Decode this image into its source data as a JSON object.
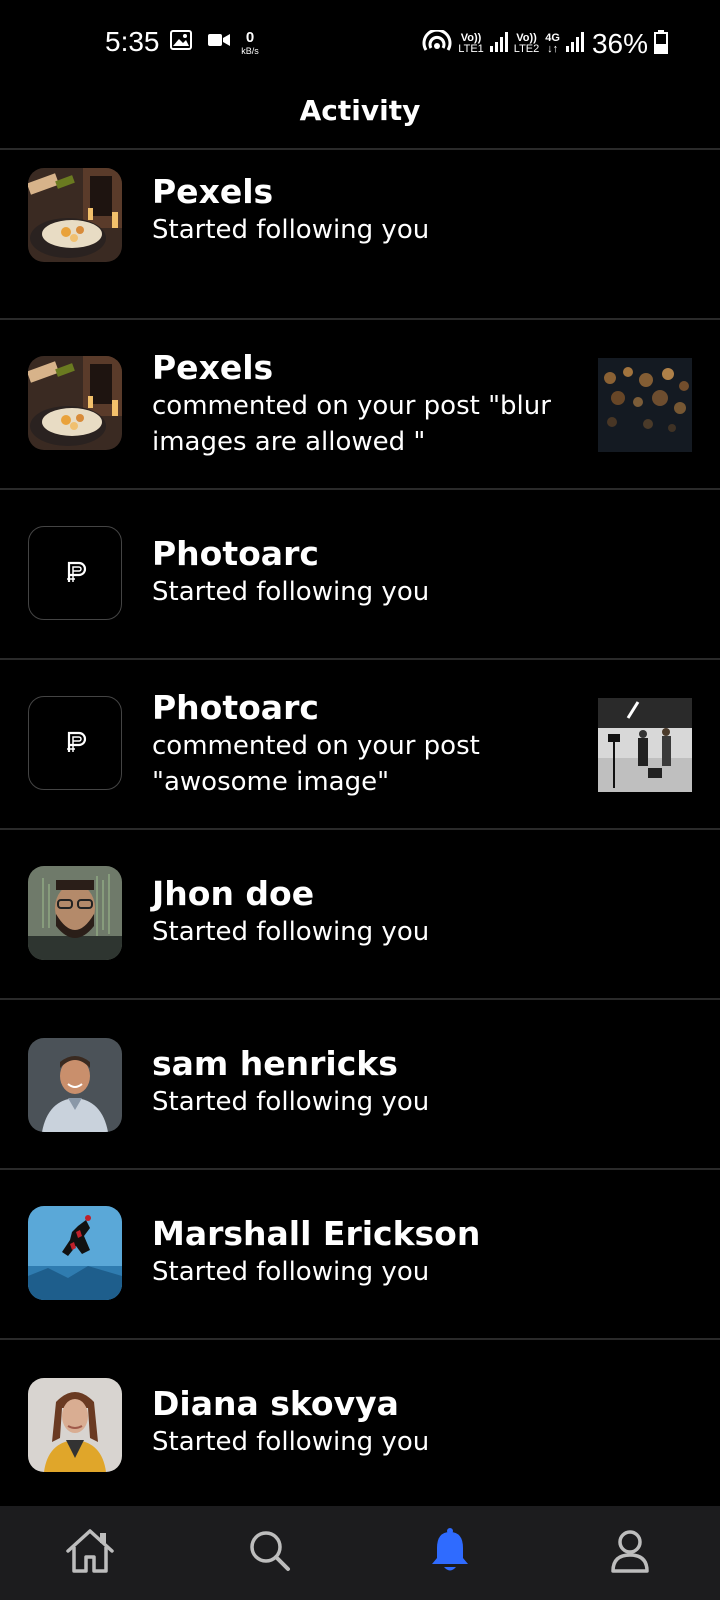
{
  "status_bar": {
    "time": "5:35",
    "net_speed_value": "0",
    "net_speed_unit": "kB/s",
    "sim1_top": "Vo))",
    "sim1_bottom": "LTE1",
    "sim2_top": "Vo))",
    "sim2_bottom": "LTE2",
    "network_type": "4G",
    "battery": "36%",
    "icons_left": [
      "gallery-icon",
      "video-camera-icon"
    ],
    "icons_right": [
      "hotspot-icon",
      "signal-icon",
      "signal-icon",
      "battery-icon"
    ]
  },
  "header": {
    "title": "Activity"
  },
  "notifications": [
    {
      "name": "Pexels",
      "text": "Started following you",
      "avatar": "food-photo",
      "thumb": null
    },
    {
      "name": "Pexels",
      "text": "commented on your post \"blur images are allowed \"",
      "avatar": "food-photo",
      "thumb": "bokeh-lights"
    },
    {
      "name": "Photoarc",
      "text": "Started following you",
      "avatar": "photoarc-logo",
      "thumb": null
    },
    {
      "name": "Photoarc",
      "text": "commented on your post \"awosome image\"",
      "avatar": "photoarc-logo",
      "thumb": "studio-photo"
    },
    {
      "name": "Jhon doe",
      "text": "Started following you",
      "avatar": "man-with-glasses",
      "thumb": null
    },
    {
      "name": "sam henricks",
      "text": "Started following you",
      "avatar": "smiling-man",
      "thumb": null
    },
    {
      "name": "Marshall Erickson",
      "text": "Started following you",
      "avatar": "spider-hero",
      "thumb": null
    },
    {
      "name": "Diana skovya",
      "text": "Started following you",
      "avatar": "woman-yellow-jacket",
      "thumb": null
    }
  ],
  "bottom_nav": {
    "items": [
      {
        "icon": "home-icon",
        "active": false
      },
      {
        "icon": "search-icon",
        "active": false
      },
      {
        "icon": "bell-icon",
        "active": true
      },
      {
        "icon": "profile-icon",
        "active": false
      }
    ],
    "active_color": "#2f6bff",
    "inactive_color": "#bdbdbd"
  }
}
